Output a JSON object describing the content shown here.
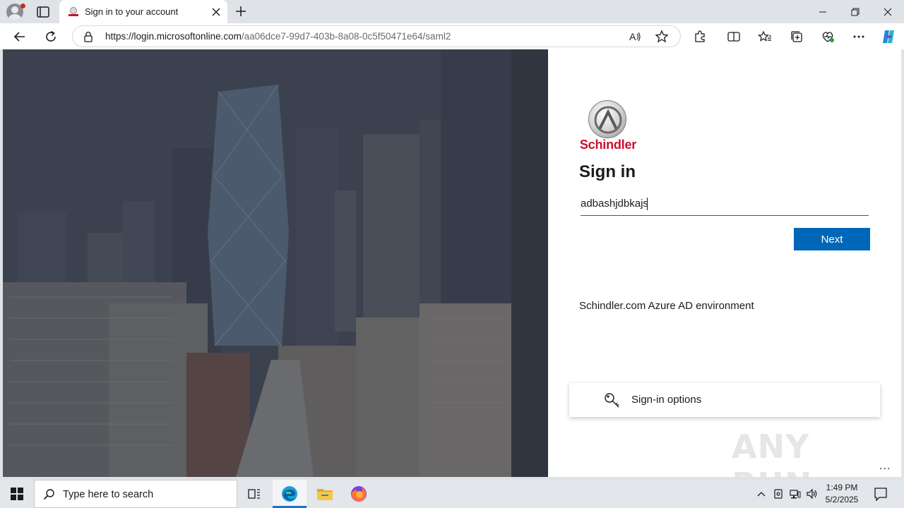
{
  "browser": {
    "tab": {
      "title": "Sign in to your account"
    },
    "address": {
      "host": "https://login.microsoftonline.com",
      "path": "/aa06dce7-99d7-403b-8a08-0c5f50471e64/saml2"
    }
  },
  "signin": {
    "brand": "Schindler",
    "title": "Sign in",
    "username_value": "adbashjdbkajs",
    "next_label": "Next",
    "environment_text": "Schindler.com Azure AD environment",
    "options_label": "Sign-in options",
    "watermark": "ANY RUN",
    "more": "..."
  },
  "taskbar": {
    "search_placeholder": "Type here to search",
    "time": "1:49 PM",
    "date": "5/2/2025"
  },
  "colors": {
    "accent": "#0067b8",
    "brand_red": "#c8102e"
  }
}
